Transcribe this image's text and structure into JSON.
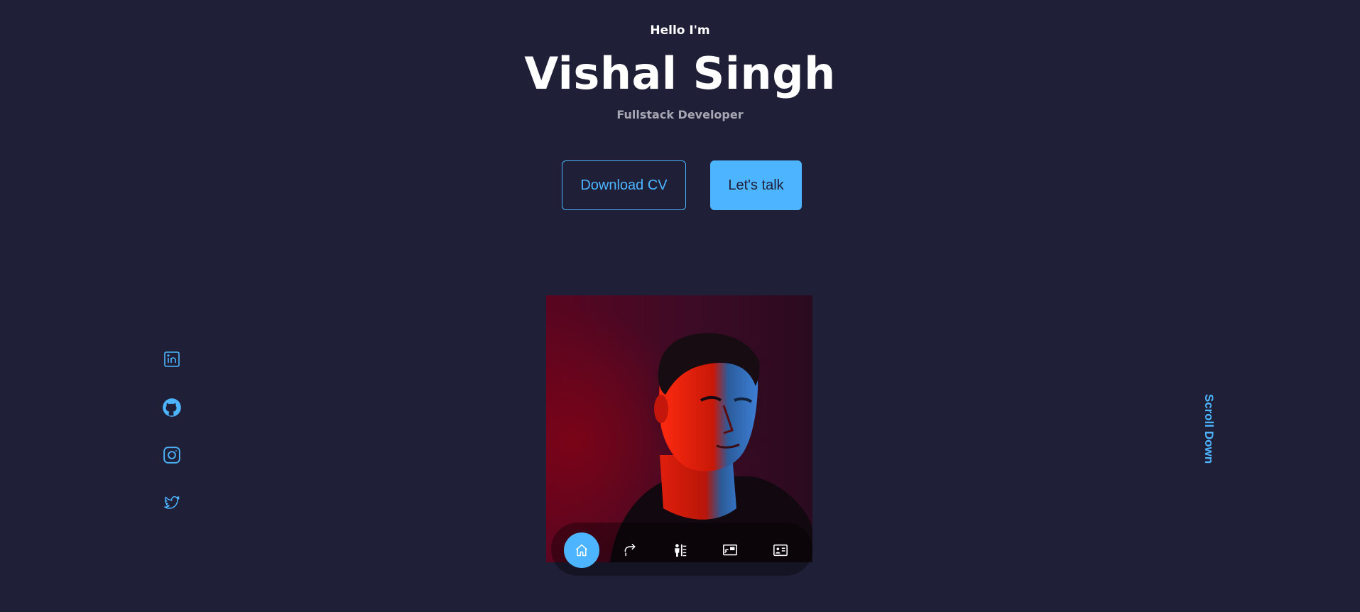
{
  "header": {
    "greeting": "Hello I'm",
    "name": "Vishal Singh",
    "role": "Fullstack Developer"
  },
  "cta": {
    "download_label": "Download CV",
    "talk_label": "Let's talk"
  },
  "socials": [
    {
      "icon": "linkedin-icon"
    },
    {
      "icon": "github-icon"
    },
    {
      "icon": "instagram-icon"
    },
    {
      "icon": "twitter-icon"
    }
  ],
  "nav": {
    "items": [
      {
        "icon": "home-icon",
        "active": true
      },
      {
        "icon": "share-icon",
        "active": false
      },
      {
        "icon": "person-list-icon",
        "active": false
      },
      {
        "icon": "screen-icon",
        "active": false
      },
      {
        "icon": "contact-card-icon",
        "active": false
      }
    ]
  },
  "scroll": {
    "label": "Scroll Down"
  },
  "colors": {
    "background": "#1f1f38",
    "accent": "#4db5ff",
    "text": "#ffffff",
    "muted": "#a7a7b3"
  }
}
